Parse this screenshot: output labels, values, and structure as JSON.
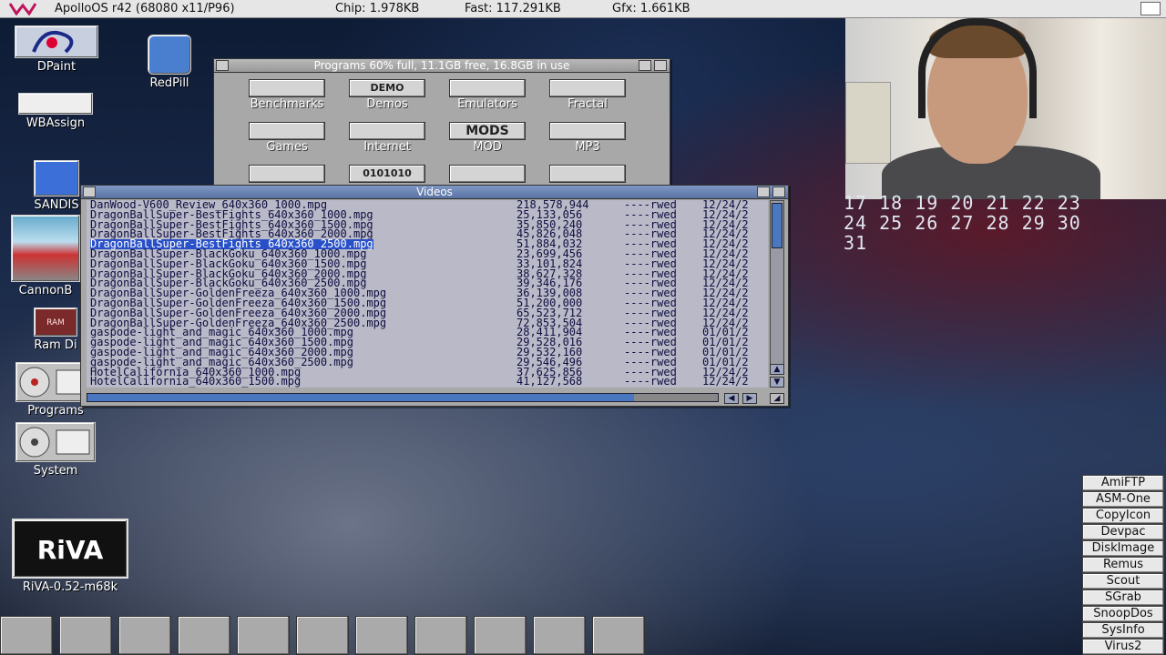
{
  "screenbar": {
    "title": "ApolloOS r42 (68080 x11/P96)",
    "chip": "Chip: 1.978KB",
    "fast": "Fast: 117.291KB",
    "gfx": "Gfx: 1.661KB"
  },
  "desktop_icons": [
    {
      "label": "DPaint",
      "icon": "dpaint-icon"
    },
    {
      "label": "RedPill",
      "icon": "redpill-icon"
    },
    {
      "label": "WBAssign",
      "icon": "wbassign-icon"
    },
    {
      "label": "SANDIS",
      "icon": "disk-icon"
    },
    {
      "label": "CannonB",
      "icon": "cannonball-icon"
    },
    {
      "label": "Ram Di",
      "icon": "ram-disk-icon"
    },
    {
      "label": "Programs",
      "icon": "harddisk-icon"
    },
    {
      "label": "System",
      "icon": "harddisk-icon"
    },
    {
      "label": "RiVA-0.52-m68k",
      "icon": "riva-icon"
    }
  ],
  "riva_logo": "RiVA",
  "programs_window": {
    "title": "Programs  60% full, 11.1GB free, 16.8GB in use",
    "items": [
      {
        "label": "Benchmarks",
        "badge": ""
      },
      {
        "label": "Demos",
        "badge": "DEMO"
      },
      {
        "label": "Emulators",
        "badge": ""
      },
      {
        "label": "Fractal",
        "badge": ""
      },
      {
        "label": "Games",
        "badge": ""
      },
      {
        "label": "Internet",
        "badge": ""
      },
      {
        "label": "MOD",
        "badge": "MODS"
      },
      {
        "label": "MP3",
        "badge": ""
      },
      {
        "label": "",
        "badge": ""
      },
      {
        "label": "",
        "badge": "0101010"
      },
      {
        "label": "",
        "badge": ""
      },
      {
        "label": "",
        "badge": ""
      }
    ]
  },
  "videos_window": {
    "title": "Videos",
    "files": [
      {
        "name": "DanWood-V600_Review_640x360_1000.mpg",
        "size": "218,578,944",
        "prot": "----rwed",
        "date": "12/24/2"
      },
      {
        "name": "DragonBallSuper-BestFights_640x360_1000.mpg",
        "size": "25,133,056",
        "prot": "----rwed",
        "date": "12/24/2"
      },
      {
        "name": "DragonBallSuper-BestFights_640x360_1500.mpg",
        "size": "35,850,240",
        "prot": "----rwed",
        "date": "12/24/2"
      },
      {
        "name": "DragonBallSuper-BestFights_640x360_2000.mpg",
        "size": "45,826,048",
        "prot": "----rwed",
        "date": "12/24/2"
      },
      {
        "name": "DragonBallSuper-BestFights_640x360_2500.mpg",
        "size": "51,884,032",
        "prot": "----rwed",
        "date": "12/24/2",
        "selected": true
      },
      {
        "name": "DragonBallSuper-BlackGoku_640x360_1000.mpg",
        "size": "23,699,456",
        "prot": "----rwed",
        "date": "12/24/2"
      },
      {
        "name": "DragonBallSuper-BlackGoku_640x360_1500.mpg",
        "size": "33,101,824",
        "prot": "----rwed",
        "date": "12/24/2"
      },
      {
        "name": "DragonBallSuper-BlackGoku_640x360_2000.mpg",
        "size": "38,627,328",
        "prot": "----rwed",
        "date": "12/24/2"
      },
      {
        "name": "DragonBallSuper-BlackGoku_640x360_2500.mpg",
        "size": "39,346,176",
        "prot": "----rwed",
        "date": "12/24/2"
      },
      {
        "name": "DragonBallSuper-GoldenFreeza_640x360_1000.mpg",
        "size": "36,139,008",
        "prot": "----rwed",
        "date": "12/24/2"
      },
      {
        "name": "DragonBallSuper-GoldenFreeza_640x360_1500.mpg",
        "size": "51,200,000",
        "prot": "----rwed",
        "date": "12/24/2"
      },
      {
        "name": "DragonBallSuper-GoldenFreeza_640x360_2000.mpg",
        "size": "65,523,712",
        "prot": "----rwed",
        "date": "12/24/2"
      },
      {
        "name": "DragonBallSuper-GoldenFreeza_640x360_2500.mpg",
        "size": "72,853,504",
        "prot": "----rwed",
        "date": "12/24/2"
      },
      {
        "name": "gaspode-light_and_magic_640x360_1000.mpg",
        "size": "28,411,904",
        "prot": "----rwed",
        "date": "01/01/2"
      },
      {
        "name": "gaspode-light_and_magic_640x360_1500.mpg",
        "size": "29,528,016",
        "prot": "----rwed",
        "date": "01/01/2"
      },
      {
        "name": "gaspode-light_and_magic_640x360_2000.mpg",
        "size": "29,532,160",
        "prot": "----rwed",
        "date": "01/01/2"
      },
      {
        "name": "gaspode-light_and_magic_640x360_2500.mpg",
        "size": "29,546,496",
        "prot": "----rwed",
        "date": "01/01/2"
      },
      {
        "name": "HotelCalifornia_640x360_1000.mpg",
        "size": "37,625,856",
        "prot": "----rwed",
        "date": "12/24/2"
      },
      {
        "name": "HotelCalifornia_640x360_1500.mpg",
        "size": "41,127,568",
        "prot": "----rwed",
        "date": "12/24/2"
      }
    ]
  },
  "calendar": {
    "row1": "17 18 19 20 21 22 23",
    "row2": "24 25 26 27 28 29 30",
    "row3": "31"
  },
  "dock": [
    "AmiFTP",
    "ASM-One",
    "CopyIcon",
    "Devpac",
    "DiskImage",
    "Remus",
    "Scout",
    "SGrab",
    "SnoopDos",
    "SysInfo",
    "Virus2"
  ],
  "taskbar": [
    {
      "icon": "ibrowse-icon"
    },
    {
      "icon": "eye-icon"
    },
    {
      "icon": "calculator-icon"
    },
    {
      "icon": "joystick-icon"
    },
    {
      "icon": "shell-icon"
    },
    {
      "icon": "editor-icon"
    },
    {
      "icon": "audio-icon"
    },
    {
      "icon": "film-icon"
    },
    {
      "icon": "s-logo-icon"
    },
    {
      "icon": "folder-icon"
    },
    {
      "icon": "save-icon"
    }
  ],
  "colors": {
    "selection": "#2850c8",
    "titlebar": "#6a82b3",
    "window_bg": "#a8a8a8"
  }
}
